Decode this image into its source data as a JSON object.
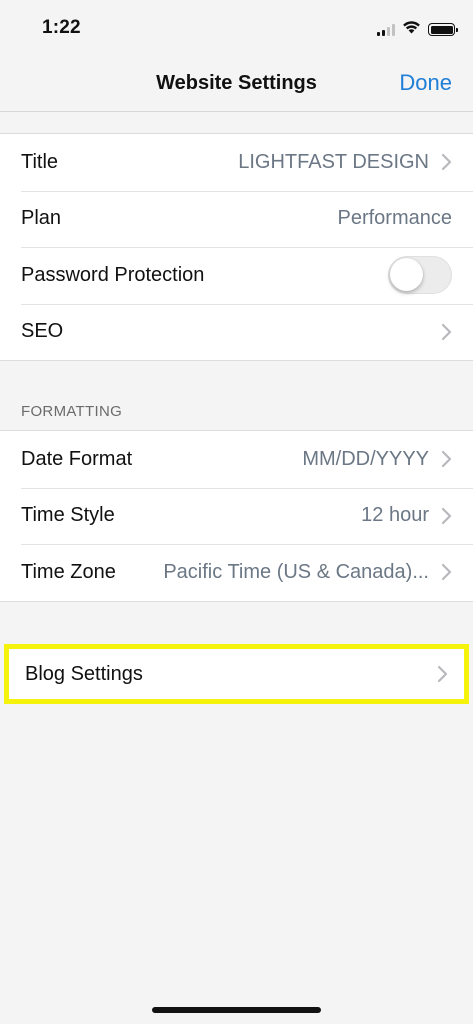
{
  "status_bar": {
    "time": "1:22",
    "signal_icon": "cellular-signal-icon",
    "wifi_icon": "wifi-icon",
    "battery_icon": "battery-icon"
  },
  "navbar": {
    "title": "Website Settings",
    "done_label": "Done",
    "accent_color": "#1f7fd6"
  },
  "general": {
    "rows": [
      {
        "label": "Title",
        "value": "LIGHTFAST DESIGN",
        "chevron": true
      },
      {
        "label": "Plan",
        "value": "Performance",
        "chevron": false
      },
      {
        "label": "Password Protection",
        "toggle_on": false
      },
      {
        "label": "SEO",
        "value": "",
        "chevron": true
      }
    ]
  },
  "formatting": {
    "header": "FORMATTING",
    "rows": [
      {
        "label": "Date Format",
        "value": "MM/DD/YYYY",
        "chevron": true
      },
      {
        "label": "Time Style",
        "value": "12 hour",
        "chevron": true
      },
      {
        "label": "Time Zone",
        "value": "Pacific Time (US & Canada)...",
        "chevron": true
      }
    ]
  },
  "blog": {
    "label": "Blog Settings",
    "highlight_color": "#f5f20c"
  }
}
